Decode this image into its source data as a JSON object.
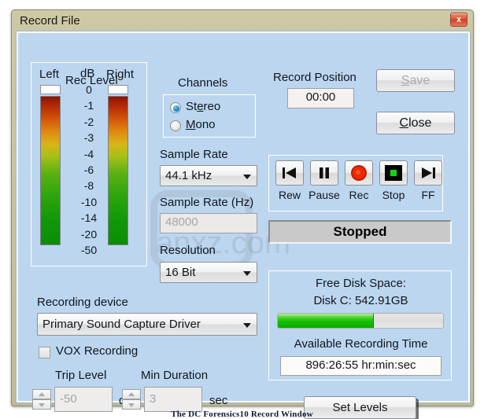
{
  "window": {
    "title": "Record File",
    "close_icon": "close-icon",
    "close_label": "x"
  },
  "rec_level": {
    "group_title": "Rec Level",
    "left_label": "Left",
    "db_label": "dB",
    "right_label": "Right",
    "db_ticks": [
      "0",
      "-1",
      "-2",
      "-3",
      "-4",
      "-6",
      "-8",
      "-10",
      "-14",
      "-20",
      "-50"
    ]
  },
  "channels": {
    "group_title": "Channels",
    "options": [
      {
        "label": "Stereo",
        "mnemonic": "e",
        "selected": true
      },
      {
        "label": "Mono",
        "mnemonic": "M",
        "selected": false
      }
    ]
  },
  "sample_rate": {
    "label": "Sample Rate",
    "value": "44.1 kHz"
  },
  "sample_rate_hz": {
    "label": "Sample Rate (Hz)",
    "value": "48000",
    "disabled": true
  },
  "resolution": {
    "label": "Resolution",
    "value": "16 Bit"
  },
  "recording_device": {
    "label": "Recording device",
    "value": "Primary Sound Capture Driver"
  },
  "vox": {
    "label": "VOX Recording",
    "checked": false
  },
  "trip_level": {
    "label": "Trip Level",
    "value": "-50",
    "unit": "dB"
  },
  "min_duration": {
    "label": "Min Duration",
    "value": "3",
    "unit": "sec"
  },
  "record_position": {
    "label": "Record Position",
    "value": "00:00"
  },
  "buttons": {
    "save": "Save",
    "save_mnemonic": "S",
    "close": "Close",
    "close_mnemonic": "C",
    "set_levels": "Set Levels"
  },
  "transport": {
    "items": [
      {
        "label": "Rew",
        "icon": "rewind-icon"
      },
      {
        "label": "Pause",
        "icon": "pause-icon"
      },
      {
        "label": "Rec",
        "icon": "record-icon"
      },
      {
        "label": "Stop",
        "icon": "stop-icon"
      },
      {
        "label": "FF",
        "icon": "fast-forward-icon"
      }
    ]
  },
  "status": {
    "text": "Stopped"
  },
  "disk": {
    "title": "Free Disk Space:",
    "drive_line": "Disk C:  542.91GB",
    "progress_percent": 58,
    "available_label": "Available Recording Time",
    "available_value": "896:26:55 hr:min:sec"
  },
  "caption": {
    "text": "The DC Forensics10 Record Window"
  },
  "colors": {
    "panel_bg": "#bcd6f0",
    "frame": "#c8c49f",
    "accent_green": "#16bf00",
    "record_red": "#d81a00",
    "close_red": "#e2573a"
  }
}
